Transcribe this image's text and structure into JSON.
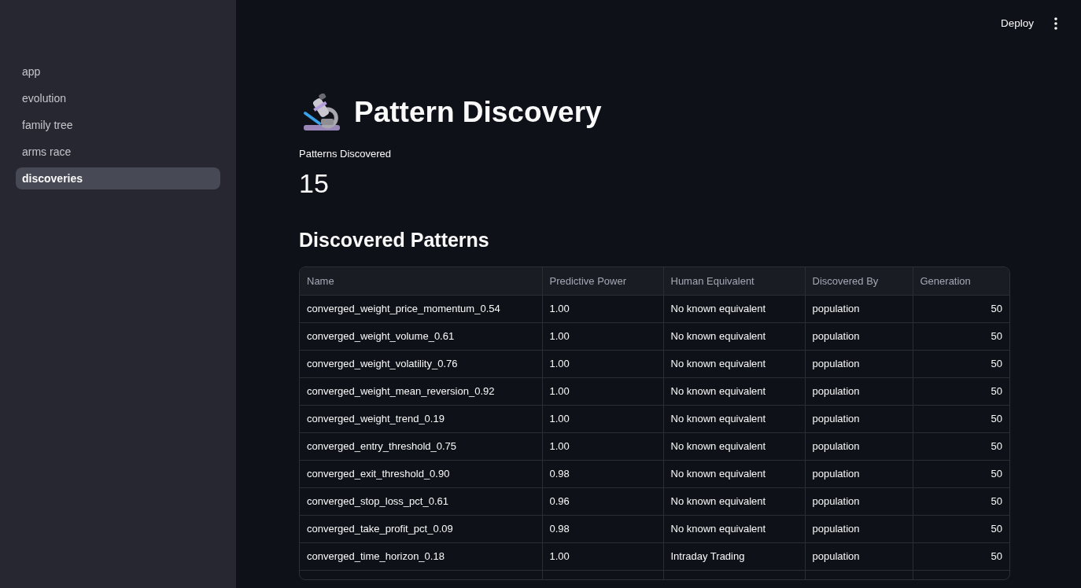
{
  "sidebar": {
    "items": [
      {
        "label": "app",
        "selected": false
      },
      {
        "label": "evolution",
        "selected": false
      },
      {
        "label": "family tree",
        "selected": false
      },
      {
        "label": "arms race",
        "selected": false
      },
      {
        "label": "discoveries",
        "selected": true
      }
    ]
  },
  "toolbar": {
    "deploy": "Deploy"
  },
  "title": "Pattern Discovery",
  "metric": {
    "label": "Patterns Discovered",
    "value": "15"
  },
  "section_title": "Discovered Patterns",
  "table": {
    "columns": [
      {
        "label": "Name",
        "kind": "text"
      },
      {
        "label": "Predictive Power",
        "kind": "text"
      },
      {
        "label": "Human Equivalent",
        "kind": "text"
      },
      {
        "label": "Discovered By",
        "kind": "text"
      },
      {
        "label": "Generation",
        "kind": "number"
      }
    ],
    "rows": [
      [
        "converged_weight_price_momentum_0.54",
        "1.00",
        "No known equivalent",
        "population",
        "50"
      ],
      [
        "converged_weight_volume_0.61",
        "1.00",
        "No known equivalent",
        "population",
        "50"
      ],
      [
        "converged_weight_volatility_0.76",
        "1.00",
        "No known equivalent",
        "population",
        "50"
      ],
      [
        "converged_weight_mean_reversion_0.92",
        "1.00",
        "No known equivalent",
        "population",
        "50"
      ],
      [
        "converged_weight_trend_0.19",
        "1.00",
        "No known equivalent",
        "population",
        "50"
      ],
      [
        "converged_entry_threshold_0.75",
        "1.00",
        "No known equivalent",
        "population",
        "50"
      ],
      [
        "converged_exit_threshold_0.90",
        "0.98",
        "No known equivalent",
        "population",
        "50"
      ],
      [
        "converged_stop_loss_pct_0.61",
        "0.96",
        "No known equivalent",
        "population",
        "50"
      ],
      [
        "converged_take_profit_pct_0.09",
        "0.98",
        "No known equivalent",
        "population",
        "50"
      ],
      [
        "converged_time_horizon_0.18",
        "1.00",
        "Intraday Trading",
        "population",
        "50"
      ]
    ]
  }
}
